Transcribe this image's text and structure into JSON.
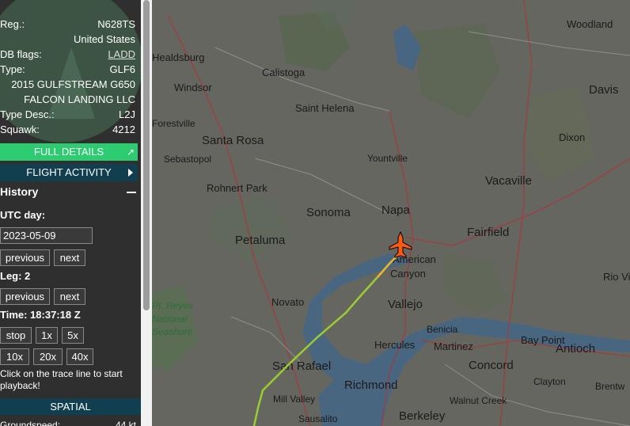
{
  "aircraft": {
    "reg_label": "Reg.:",
    "reg": "N628TS",
    "country": "United States",
    "db_flags_label": "DB flags:",
    "db_flags": "LADD",
    "type_label": "Type:",
    "type": "GLF6",
    "model": "2015 GULFSTREAM G650",
    "owner": "FALCON LANDING LLC",
    "type_desc_label": "Type Desc.:",
    "type_desc": "L2J",
    "squawk_label": "Squawk:",
    "squawk": "4212"
  },
  "buttons": {
    "full_details": "FULL DETAILS",
    "full_details_icon": "external-link-icon",
    "flight_activity": "FLIGHT ACTIVITY",
    "spatial": "SPATIAL"
  },
  "history": {
    "title": "History",
    "utc_day_label": "UTC day:",
    "utc_day_value": "2023-05-09",
    "previous": "previous",
    "next": "next",
    "leg_label": "Leg: 2",
    "time_label": "Time: 18:37:18 Z",
    "speeds": [
      "stop",
      "1x",
      "5x",
      "10x",
      "20x",
      "40x"
    ],
    "hint": "Click on the trace line to start playback!"
  },
  "spatial_row": {
    "label": "Groundspeed:",
    "value": "44 kt"
  },
  "map": {
    "places": [
      "Healdsburg",
      "Calistoga",
      "Windsor",
      "Saint Helena",
      "Forestville",
      "Santa Rosa",
      "Sebastopol",
      "Yountville",
      "Rohnert Park",
      "Sonoma",
      "Napa",
      "Petaluma",
      "American",
      "Canyon",
      "Novato",
      "Vallejo",
      "Benicia",
      "Hercules",
      "Martinez",
      "San Rafael",
      "Richmond",
      "Mill Valley",
      "Sausalito",
      "Berkeley",
      "Woodland",
      "Davis",
      "Dixon",
      "Vacaville",
      "Fairfield",
      "Rio Vi",
      "Bay Point",
      "Antioch",
      "Concord",
      "Clayton",
      "Brentw",
      "Walnut Creek",
      "Pt. Reyes",
      "National",
      "Seashore"
    ],
    "trail_color": "#9acd32",
    "aircraft_color": "#ff5a14",
    "aircraft_icon": "airplane-icon"
  },
  "colors": {
    "accent_green": "#2ecc71",
    "dark_teal": "#123f4f"
  }
}
